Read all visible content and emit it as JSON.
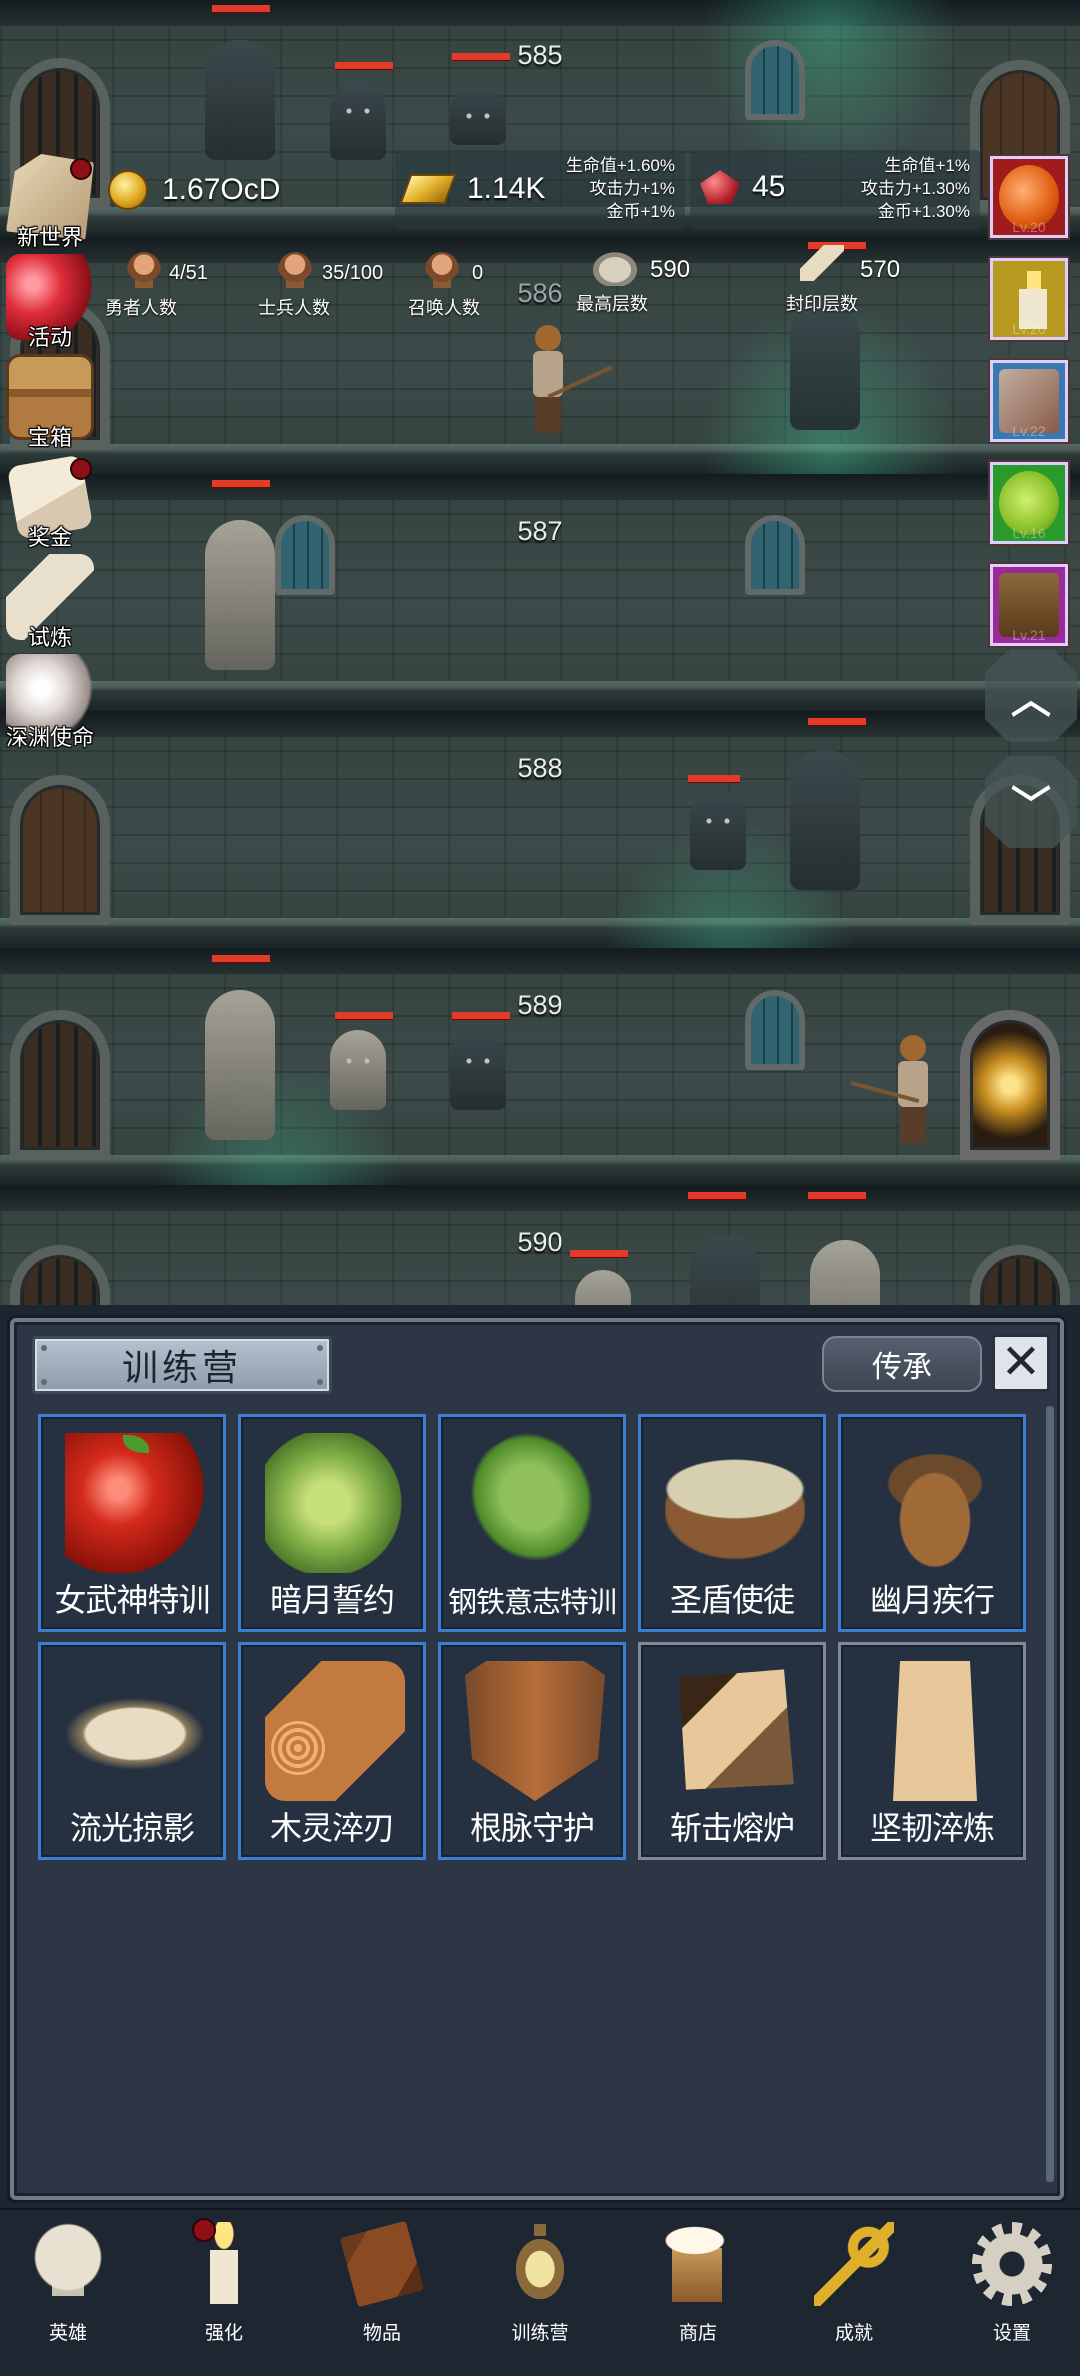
{
  "floors": [
    {
      "number": "585",
      "dim": false
    },
    {
      "number": "586",
      "dim": true
    },
    {
      "number": "587",
      "dim": false
    },
    {
      "number": "588",
      "dim": false
    },
    {
      "number": "589",
      "dim": false
    },
    {
      "number": "590",
      "dim": false
    }
  ],
  "currency": {
    "coins": "1.67OcD",
    "gold": "1.14K",
    "gems": "45"
  },
  "gold_bonus": [
    "生命值+1.60%",
    "攻击力+1%",
    "金币+1%"
  ],
  "gem_bonus": [
    "生命值+1%",
    "攻击力+1.30%",
    "金币+1.30%"
  ],
  "counters": {
    "heroes": {
      "value": "4/51",
      "label": "勇者人数"
    },
    "soldiers": {
      "value": "35/100",
      "label": "士兵人数"
    },
    "summons": {
      "value": "0",
      "label": "召唤人数"
    },
    "max_floor": {
      "value": "590",
      "label": "最高层数"
    },
    "sealed_floor": {
      "value": "570",
      "label": "封印层数"
    }
  },
  "side_menu": [
    {
      "label": "新世界",
      "badge": true
    },
    {
      "label": "活动",
      "badge": false
    },
    {
      "label": "宝箱",
      "badge": false
    },
    {
      "label": "奖金",
      "badge": true
    },
    {
      "label": "试炼",
      "badge": false
    },
    {
      "label": "深渊使命",
      "badge": false
    }
  ],
  "pets": [
    {
      "level": "Lv.20"
    },
    {
      "level": "Lv.20"
    },
    {
      "level": "Lv.22"
    },
    {
      "level": "Lv.16"
    },
    {
      "level": "Lv.21"
    }
  ],
  "panel": {
    "title": "训练营",
    "inherit_label": "传承",
    "close_icon": "close-icon",
    "items": [
      {
        "name": "女武神特训",
        "icon": "apple-icon",
        "highlighted": true
      },
      {
        "name": "暗月誓约",
        "icon": "cabbage-icon",
        "highlighted": true
      },
      {
        "name": "钢铁意志特训",
        "icon": "leaf-icon",
        "highlighted": true
      },
      {
        "name": "圣盾使徒",
        "icon": "porridge-bowl-icon",
        "highlighted": true
      },
      {
        "name": "幽月疾行",
        "icon": "acorn-icon",
        "highlighted": true
      },
      {
        "name": "流光掠影",
        "icon": "flatbread-icon",
        "highlighted": true
      },
      {
        "name": "木灵淬刃",
        "icon": "log-icon",
        "highlighted": true
      },
      {
        "name": "根脉守护",
        "icon": "wooden-shield-icon",
        "highlighted": true
      },
      {
        "name": "斩击熔炉",
        "icon": "wood-block-icon",
        "highlighted": false
      },
      {
        "name": "坚韧淬炼",
        "icon": "wood-plank-icon",
        "highlighted": false
      }
    ]
  },
  "bottom_nav": [
    {
      "label": "英雄",
      "icon": "skull-icon",
      "badge": false
    },
    {
      "label": "强化",
      "icon": "candle-icon",
      "badge": true
    },
    {
      "label": "物品",
      "icon": "book-icon",
      "badge": false
    },
    {
      "label": "训练营",
      "icon": "lantern-icon",
      "badge": false
    },
    {
      "label": "商店",
      "icon": "beer-mug-icon",
      "badge": false
    },
    {
      "label": "成就",
      "icon": "key-icon",
      "badge": false
    },
    {
      "label": "设置",
      "icon": "gear-icon",
      "badge": false
    }
  ],
  "colors": {
    "card_border_active": "#3b7fd0",
    "card_border_inactive": "#7f8a96",
    "hp_bar": "#e23b2a",
    "badge": "#8f0f16"
  }
}
